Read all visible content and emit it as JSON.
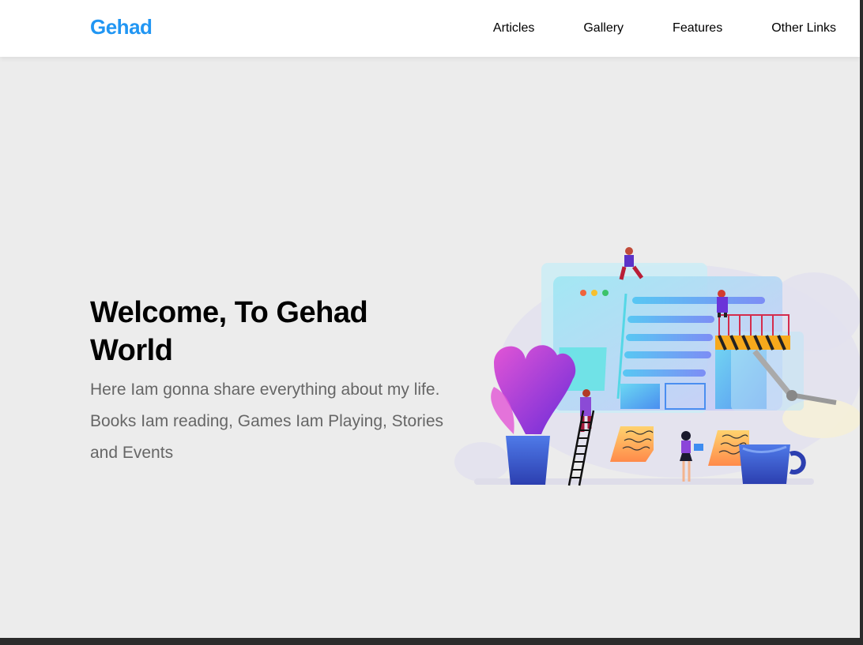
{
  "header": {
    "logo": "Gehad",
    "nav": [
      "Articles",
      "Gallery",
      "Features",
      "Other Links"
    ]
  },
  "hero": {
    "title": "Welcome, To Gehad World",
    "description": "Here Iam gonna share everything about my life. Books Iam reading, Games Iam Playing, Stories and Events"
  },
  "colors": {
    "brand": "#2196f3",
    "background": "#ececec",
    "text_muted": "#666666"
  }
}
